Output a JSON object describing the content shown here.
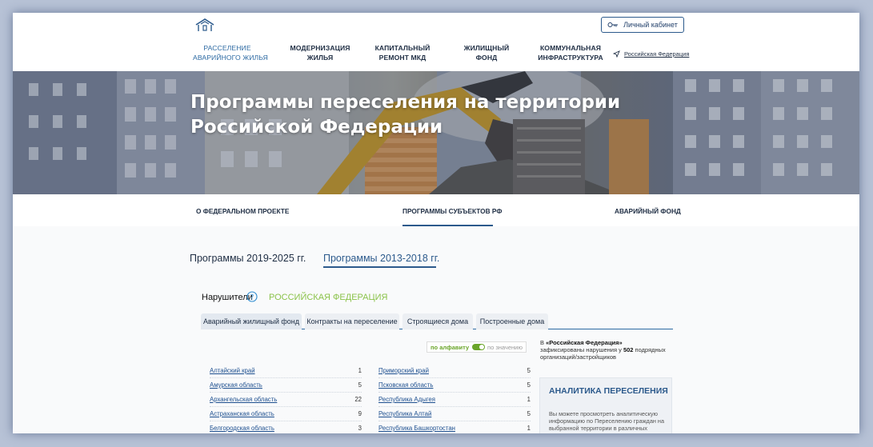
{
  "header": {
    "cabinet_label": "Личный кабинет",
    "nav": [
      {
        "line1": "РАССЕЛЕНИЕ",
        "line2": "АВАРИЙНОГО ЖИЛЬЯ"
      },
      {
        "line1": "МОДЕРНИЗАЦИЯ",
        "line2": "ЖИЛЬЯ"
      },
      {
        "line1": "КАПИТАЛЬНЫЙ",
        "line2": "РЕМОНТ МКД"
      },
      {
        "line1": "ЖИЛИЩНЫЙ",
        "line2": "ФОНД"
      },
      {
        "line1": "КОММУНАЛЬНАЯ",
        "line2": "ИНФРАСТРУКТУРА"
      }
    ],
    "region_link": "Российская Федерация"
  },
  "hero": {
    "title_line1": "Программы переселения на территории",
    "title_line2": "Российской Федерации"
  },
  "subnav": {
    "items": [
      "О ФЕДЕРАЛЬНОМ ПРОЕКТЕ",
      "ПРОГРАММЫ СУБЪЕКТОВ РФ",
      "АВАРИЙНЫЙ ФОНД"
    ]
  },
  "programs": {
    "tab_2019": "Программы 2019-2025 гг.",
    "tab_2013": "Программы 2013-2018 гг."
  },
  "violators": {
    "label": "Нарушители",
    "region": "РОССИЙСКАЯ ФЕДЕРАЦИЯ",
    "tabs": [
      "Аварийный жилищный фонд",
      "Контракты на переселение",
      "Строящиеся дома",
      "Построенные дома"
    ],
    "toggle_left": "по алфавиту",
    "toggle_right": "по значению",
    "left_list": [
      {
        "name": "Алтайский край",
        "count": "1"
      },
      {
        "name": "Амурская область",
        "count": "5"
      },
      {
        "name": "Архангельская область",
        "count": "22"
      },
      {
        "name": "Астраханская область",
        "count": "9"
      },
      {
        "name": "Белгородская область",
        "count": "3"
      }
    ],
    "right_list": [
      {
        "name": "Приморский край",
        "count": "5"
      },
      {
        "name": "Псковская область",
        "count": "5"
      },
      {
        "name": "Республика Адыгея",
        "count": "1"
      },
      {
        "name": "Республика Алтай",
        "count": "5"
      },
      {
        "name": "Республика Башкортостан",
        "count": "1"
      }
    ]
  },
  "info": {
    "prefix": "В ",
    "region": "«Российская Федерация»",
    "middle": " зафиксированы нарушения у ",
    "count": "502",
    "suffix": " подрядных организаций/застройщиков"
  },
  "analytics": {
    "title": "АНАЛИТИКА ПЕРЕСЕЛЕНИЯ",
    "text": "Вы можете просмотреть аналитическую информацию по Переселению граждан на выбранной территории в различных разрезах"
  },
  "colors": {
    "accent": "#2c5a8c",
    "region_green": "#8bc34a",
    "link": "#1d4f8f"
  }
}
